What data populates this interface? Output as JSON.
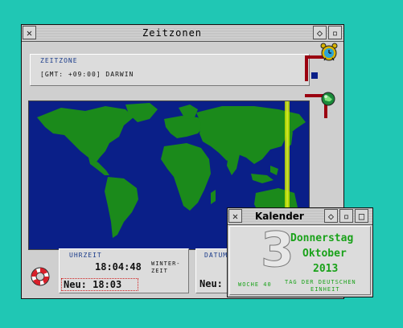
{
  "main_window": {
    "title": "Zeitzonen",
    "zone_label": "ZEITZONE",
    "zone_value": "[GMT: +09:00] DARWIN",
    "uhrzeit_label": "UHRZEIT",
    "time_value": "18:04:48",
    "time_mode_line1": "WINTER-",
    "time_mode_line2": "ZEIT",
    "new_time": "Neu: 18:03",
    "datum_label": "DATUM",
    "new_date_prefix": "Neu:"
  },
  "calendar_window": {
    "title": "Kalender",
    "day_number": "3",
    "weekday": "Donnerstag",
    "month": "Oktober",
    "year": "2013",
    "week_label": "WOCHE 40",
    "holiday_line1": "TAG DER DEUTSCHEN",
    "holiday_line2": "EINHEIT"
  },
  "colors": {
    "desktop": "#20c7b4",
    "ocean": "#0a1f88",
    "land": "#1b8a1b",
    "accent_green": "#1aa21a",
    "marker_red": "#9a0010"
  },
  "icons": {
    "close": "close-icon",
    "depth": "depth-icon",
    "zoom": "zoom-icon",
    "alarm_clock": "alarm-clock-icon",
    "globe": "globe-icon",
    "lifebuoy": "lifebuoy-icon"
  }
}
